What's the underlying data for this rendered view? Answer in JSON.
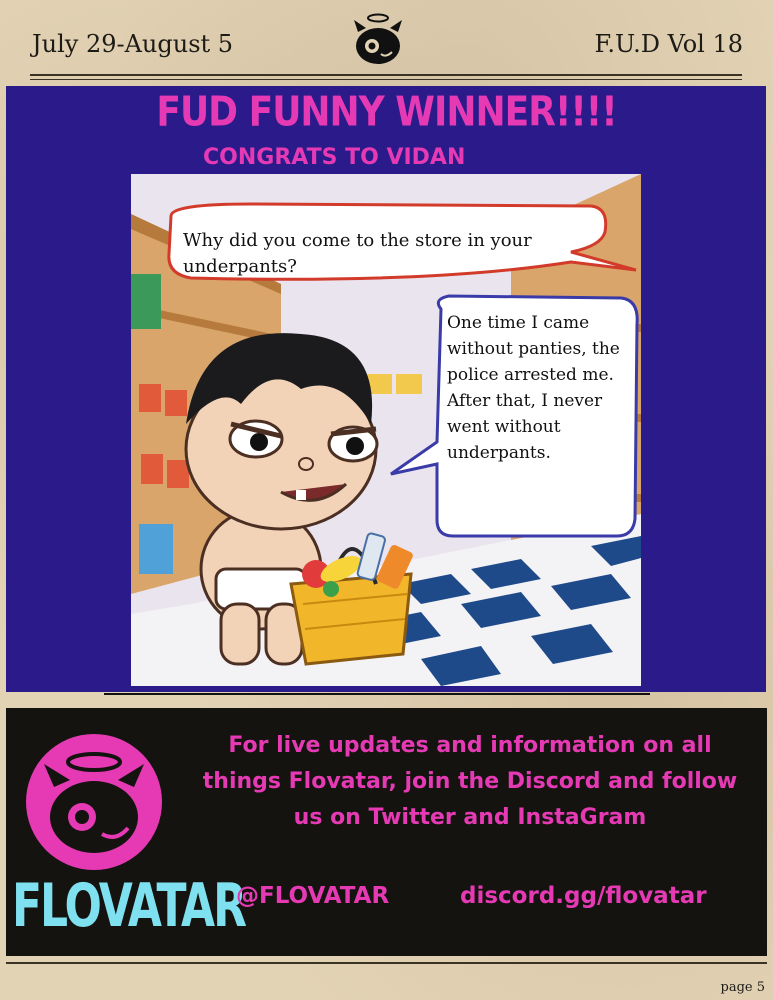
{
  "header": {
    "date": "July 29-August 5",
    "volume": "F.U.D Vol 18"
  },
  "winner": {
    "title": "FUD FUNNY WINNER!!!!",
    "subtitle": "CONGRATS TO VIDAN"
  },
  "comic": {
    "question": "Why did you come to the store in your underpants?",
    "answer": "One time I came without panties, the police arrested me. After that, I never went without underpants."
  },
  "footer": {
    "message": "For live updates and information on all things Flovatar, join the Discord and follow us on Twitter and InstaGram",
    "handle": "@FLOVATAR",
    "discord": "discord.gg/flovatar",
    "brand": "FLOVATAR"
  },
  "page_number": "page 5",
  "colors": {
    "accent": "#e63ab5",
    "panel": "#2a1a8a",
    "footer_bg": "#151310",
    "brand": "#7fe0f0"
  }
}
